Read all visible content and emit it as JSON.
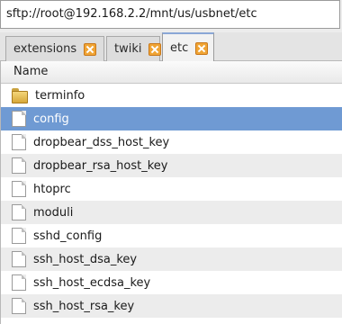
{
  "address_bar": {
    "value": "sftp://root@192.168.2.2/mnt/us/usbnet/etc"
  },
  "tabs": [
    {
      "label": "extensions",
      "active": false,
      "close_icon": "close-icon"
    },
    {
      "label": "twiki",
      "active": false,
      "close_icon": "close-icon"
    },
    {
      "label": "etc",
      "active": true,
      "close_icon": "close-icon"
    }
  ],
  "file_list": {
    "column_header": "Name",
    "items": [
      {
        "name": "terminfo",
        "type": "folder",
        "icon": "folder-icon"
      },
      {
        "name": "config",
        "type": "file",
        "icon": "file-icon",
        "selected": true
      },
      {
        "name": "dropbear_dss_host_key",
        "type": "file",
        "icon": "file-icon"
      },
      {
        "name": "dropbear_rsa_host_key",
        "type": "file",
        "icon": "file-icon"
      },
      {
        "name": "htoprc",
        "type": "file",
        "icon": "file-icon"
      },
      {
        "name": "moduli",
        "type": "file",
        "icon": "file-icon"
      },
      {
        "name": "sshd_config",
        "type": "file",
        "icon": "file-icon"
      },
      {
        "name": "ssh_host_dsa_key",
        "type": "file",
        "icon": "file-icon"
      },
      {
        "name": "ssh_host_ecdsa_key",
        "type": "file",
        "icon": "file-icon"
      },
      {
        "name": "ssh_host_rsa_key",
        "type": "file",
        "icon": "file-icon"
      }
    ]
  },
  "colors": {
    "selection": "#6f9ad3",
    "tab_close": "#f0a434",
    "alternate_row": "#ececec"
  }
}
